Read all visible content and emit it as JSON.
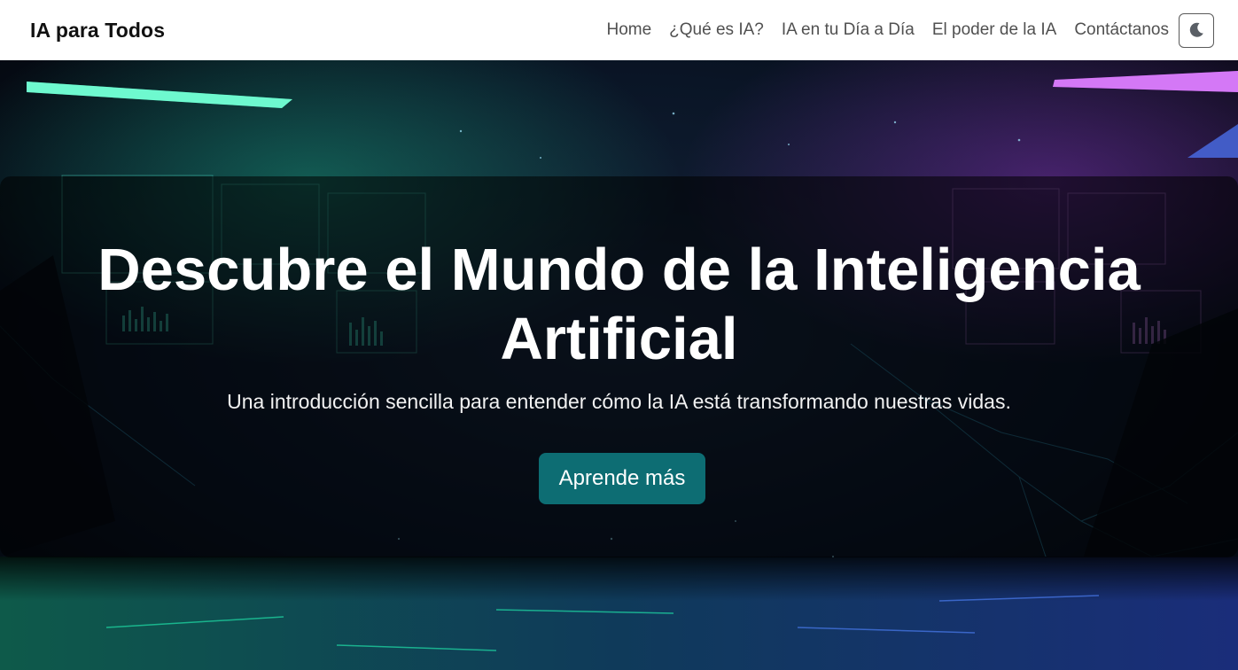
{
  "navbar": {
    "brand": "IA para Todos",
    "links": [
      {
        "label": "Home"
      },
      {
        "label": "¿Qué es IA?"
      },
      {
        "label": "IA en tu Día a Día"
      },
      {
        "label": "El poder de la IA"
      },
      {
        "label": "Contáctanos"
      }
    ],
    "theme_toggle_icon": "moon-icon"
  },
  "hero": {
    "title": "Descubre el Mundo de la Inteligencia Artificial",
    "subtitle": "Una introducción sencilla para entender cómo la IA está transformando nuestras vidas.",
    "cta_label": "Aprende más"
  },
  "colors": {
    "accent_button": "#0d6d73",
    "neon_green": "#27f5b4",
    "neon_purple": "#c13cf0",
    "background_dark": "#060d18"
  }
}
